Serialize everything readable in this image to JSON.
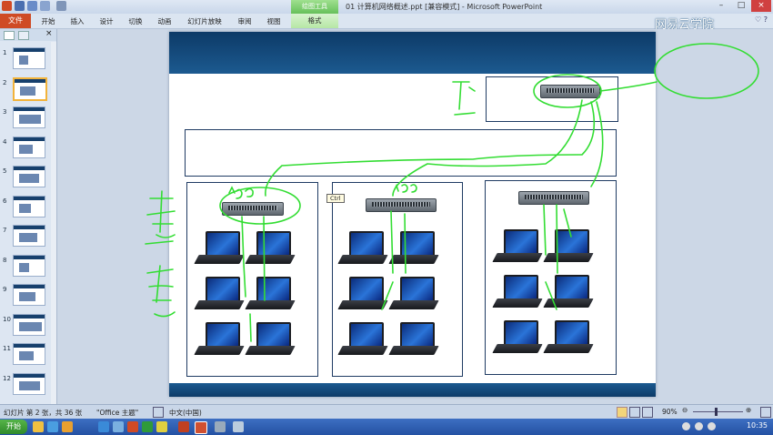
{
  "window": {
    "title": "01 计算机网络概述.ppt [兼容模式] - Microsoft PowerPoint",
    "context_group": "绘图工具",
    "watermark": "网易云学院"
  },
  "ribbon": {
    "file_tab": "文件",
    "tabs": [
      "开始",
      "插入",
      "设计",
      "切换",
      "动画",
      "幻灯片放映",
      "审阅",
      "视图"
    ],
    "context_tab": "格式"
  },
  "slide_pane": {
    "thumbnails": [
      {
        "num": "1"
      },
      {
        "num": "2",
        "selected": true
      },
      {
        "num": "3"
      },
      {
        "num": "4"
      },
      {
        "num": "5"
      },
      {
        "num": "6"
      },
      {
        "num": "7"
      },
      {
        "num": "8"
      },
      {
        "num": "9"
      },
      {
        "num": "10"
      },
      {
        "num": "11"
      },
      {
        "num": "12"
      }
    ]
  },
  "slide": {
    "switch_labels": [
      "Ctrl"
    ]
  },
  "statusbar": {
    "slide_info": "幻灯片 第 2 张，共 36 张",
    "theme": "\"Office 主题\"",
    "language": "中文(中国)",
    "zoom": "90%"
  },
  "taskbar": {
    "start": "开始",
    "clock": "10:35"
  },
  "colors": {
    "ink": "#33dd33",
    "slide_header": "#0d3a67",
    "file_tab": "#cf4b25"
  }
}
